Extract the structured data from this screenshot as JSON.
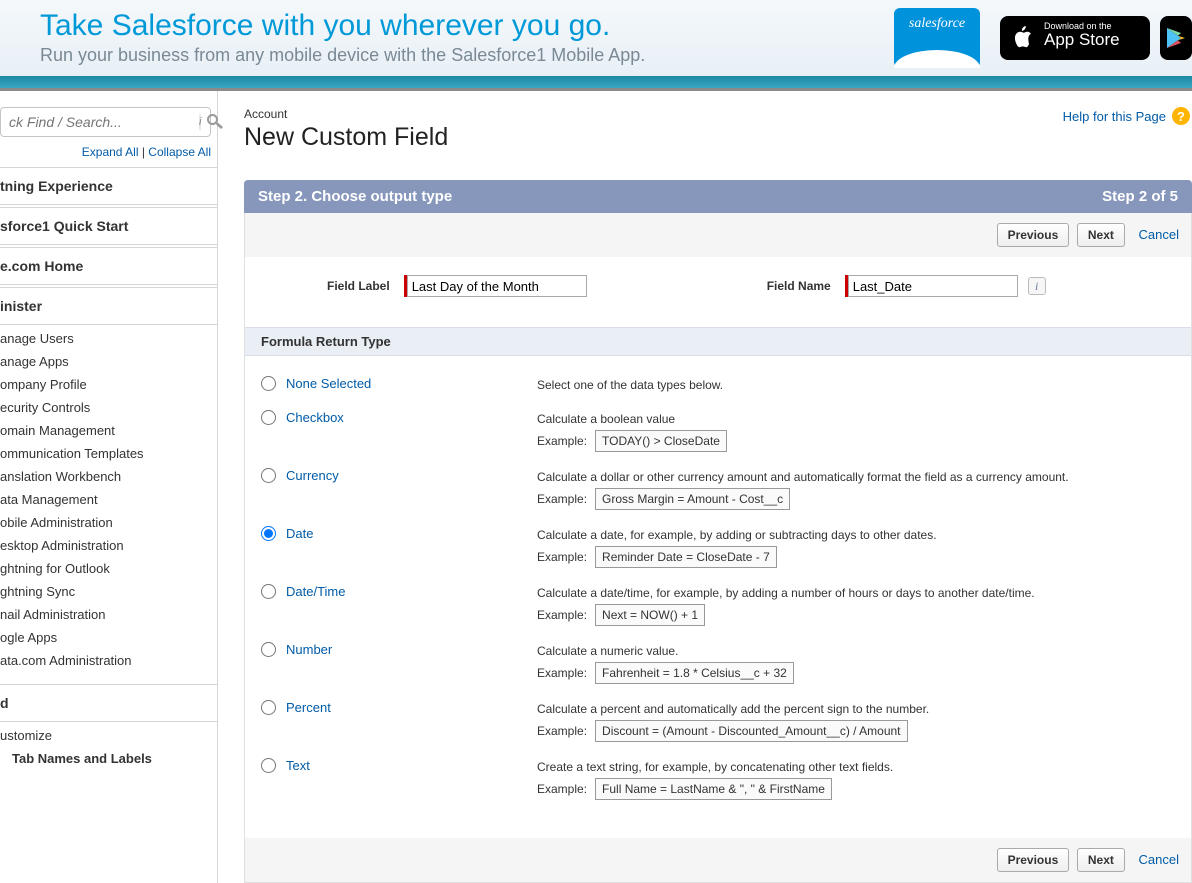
{
  "banner": {
    "title": "Take Salesforce with you wherever you go.",
    "subtitle": "Run your business from any mobile device with the Salesforce1 Mobile App.",
    "appstore_small": "Download on the",
    "appstore_big": "App Store",
    "logo_text": "salesforce"
  },
  "sidebar": {
    "search_placeholder": "ck Find / Search...",
    "expand_all": "Expand All",
    "collapse_all": "Collapse All",
    "sections": [
      "tning Experience",
      "sforce1 Quick Start",
      "e.com Home"
    ],
    "admin_head": "inister",
    "admin_items": [
      "anage Users",
      "anage Apps",
      "ompany Profile",
      "ecurity Controls",
      "omain Management",
      "ommunication Templates",
      "anslation Workbench",
      "ata Management",
      "obile Administration",
      "esktop Administration",
      "ghtning for Outlook",
      "ghtning Sync",
      "nail Administration",
      "ogle Apps",
      "ata.com Administration"
    ],
    "build_head": "d",
    "build_items": [
      "ustomize"
    ],
    "build_sub": "Tab Names and Labels"
  },
  "page": {
    "breadcrumb": "Account",
    "title": "New Custom Field",
    "help": "Help for this Page"
  },
  "step": {
    "title": "Step 2. Choose output type",
    "counter": "Step 2 of 5"
  },
  "buttons": {
    "previous": "Previous",
    "next": "Next",
    "cancel": "Cancel"
  },
  "fields": {
    "label_label": "Field Label",
    "label_value": "Last Day of the Month",
    "name_label": "Field Name",
    "name_value": "Last_Date"
  },
  "return_type_head": "Formula Return Type",
  "types": [
    {
      "key": "none",
      "name": "None Selected",
      "selected": false,
      "desc": "Select one of the data types below.",
      "example": ""
    },
    {
      "key": "checkbox",
      "name": "Checkbox",
      "selected": false,
      "desc": "Calculate a boolean value",
      "example": "TODAY() > CloseDate"
    },
    {
      "key": "currency",
      "name": "Currency",
      "selected": false,
      "desc": "Calculate a dollar or other currency amount and automatically format the field as a currency amount.",
      "example": "Gross Margin = Amount - Cost__c"
    },
    {
      "key": "date",
      "name": "Date",
      "selected": true,
      "desc": "Calculate a date, for example, by adding or subtracting days to other dates.",
      "example": "Reminder Date = CloseDate - 7"
    },
    {
      "key": "datetime",
      "name": "Date/Time",
      "selected": false,
      "desc": "Calculate a date/time, for example, by adding a number of hours or days to another date/time.",
      "example": "Next = NOW() + 1"
    },
    {
      "key": "number",
      "name": "Number",
      "selected": false,
      "desc": "Calculate a numeric value.",
      "example": "Fahrenheit = 1.8 * Celsius__c + 32"
    },
    {
      "key": "percent",
      "name": "Percent",
      "selected": false,
      "desc": "Calculate a percent and automatically add the percent sign to the number.",
      "example": "Discount = (Amount - Discounted_Amount__c) / Amount"
    },
    {
      "key": "text",
      "name": "Text",
      "selected": false,
      "desc": "Create a text string, for example, by concatenating other text fields.",
      "example": "Full Name = LastName & \", \" & FirstName"
    }
  ],
  "example_label": "Example:"
}
